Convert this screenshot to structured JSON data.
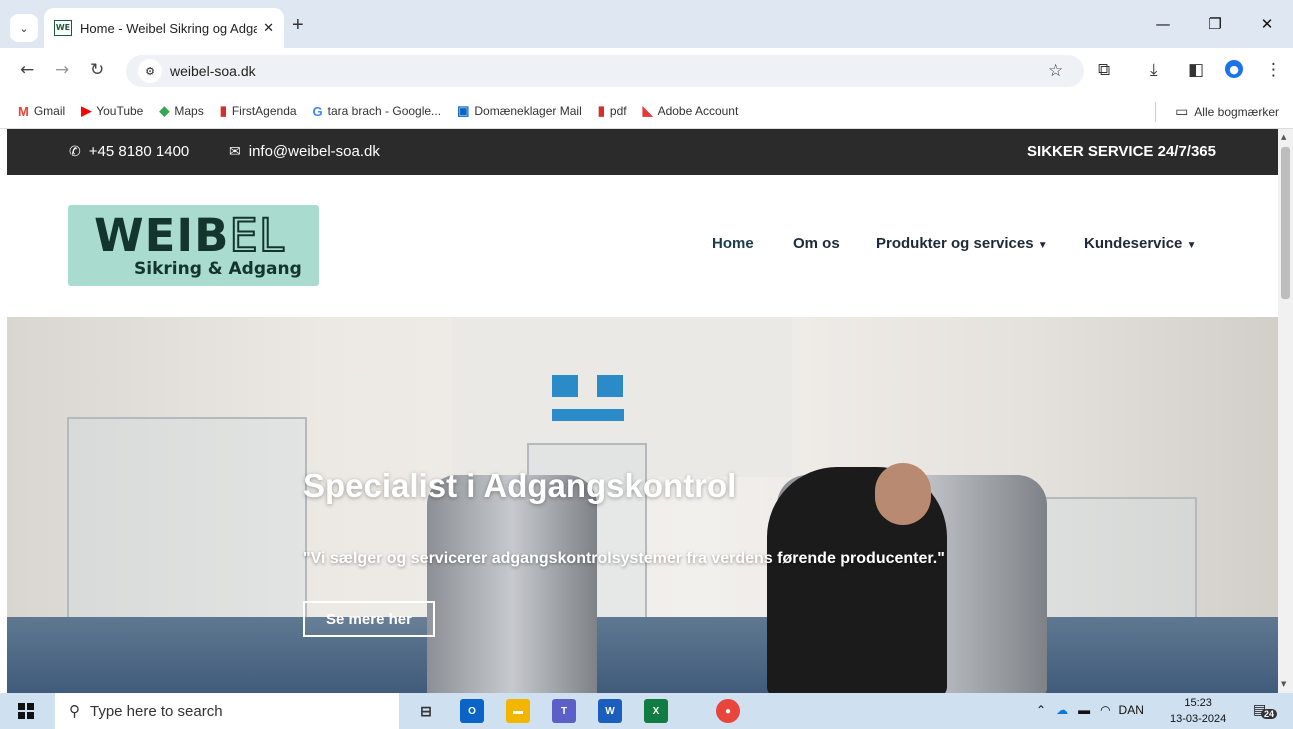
{
  "browser": {
    "tab_title": "Home - Weibel Sikring og Adga",
    "tab_favicon": "WE",
    "close_tab": "✕",
    "new_tab": "+",
    "url": "weibel-soa.dk",
    "bookmarks": [
      {
        "label": "Gmail",
        "icon": "M",
        "color": "#ea4335"
      },
      {
        "label": "YouTube",
        "icon": "▶",
        "color": "#ff0000"
      },
      {
        "label": "Maps",
        "icon": "◆",
        "color": "#34a853"
      },
      {
        "label": "FirstAgenda",
        "icon": "▮",
        "color": "#d32f2f"
      },
      {
        "label": "tara brach - Google...",
        "icon": "G",
        "color": "#4285f4"
      },
      {
        "label": "Domæneklager Mail",
        "icon": "▣",
        "color": "#0a66c2"
      },
      {
        "label": "pdf",
        "icon": "▮",
        "color": "#d32f2f"
      },
      {
        "label": "Adobe Account",
        "icon": "◣",
        "color": "#e53935"
      }
    ],
    "all_bookmarks": "Alle bogmærker"
  },
  "site": {
    "phone": "+45 8180 1400",
    "email": "info@weibel-soa.dk",
    "service": "SIKKER SERVICE 24/7/365",
    "logo_main": "WEIB",
    "logo_outline": "EL",
    "logo_sub": "Sikring & Adgang",
    "nav": [
      "Home",
      "Om os",
      "Produkter og services",
      "Kundeservice"
    ],
    "hero_title": "Specialist i Adgangskontrol",
    "hero_sub": "\"Vi sælger og servicerer adgangskontrolsystemer fra verdens førende producenter.\"",
    "hero_button": "Se mere her"
  },
  "taskbar": {
    "search_placeholder": "Type here to search",
    "language": "DAN",
    "time": "15:23",
    "date": "13-03-2024",
    "notifications": "24"
  },
  "colors": {
    "topbar": "#2b2b2b",
    "logo_bg": "#a9dccf",
    "logo_text": "#14352b"
  }
}
